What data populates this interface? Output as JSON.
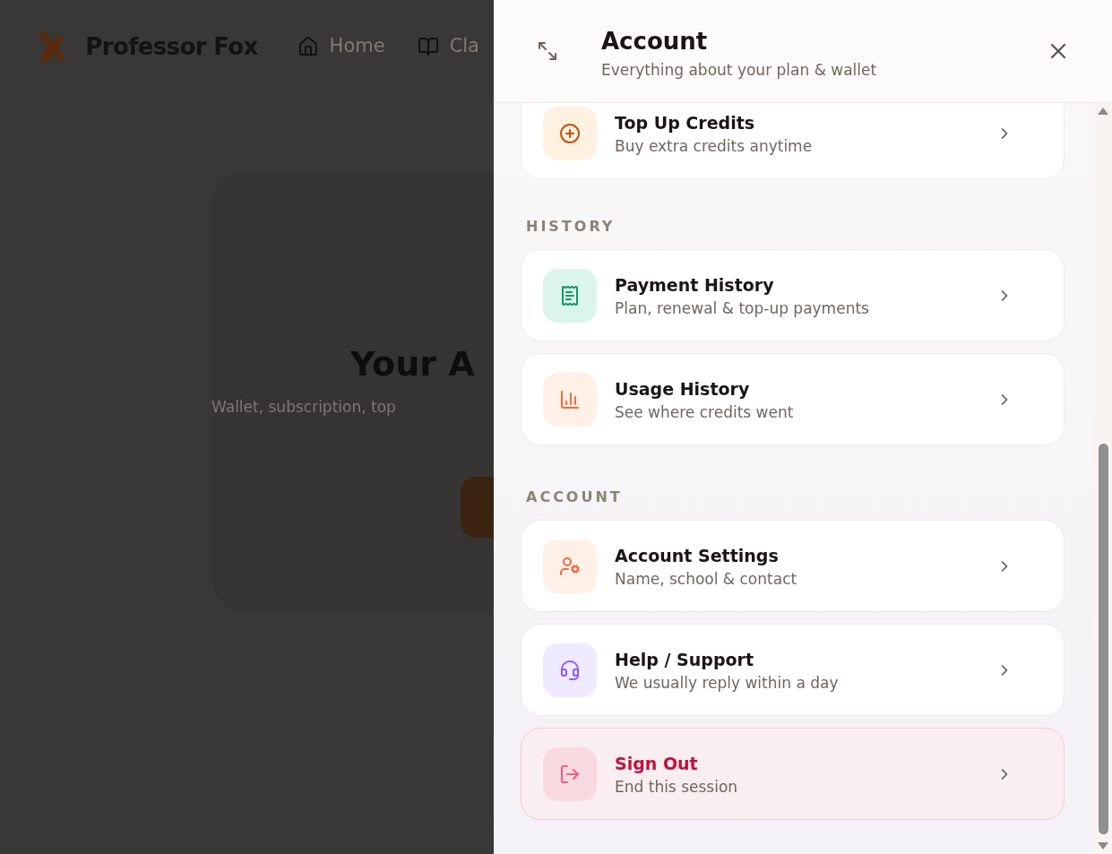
{
  "background": {
    "brand": "Professor Fox",
    "nav": [
      {
        "label": "Home",
        "kind": "home"
      },
      {
        "label": "Cla",
        "kind": "book"
      }
    ],
    "hero_title": "Your A",
    "hero_subtitle": "Wallet, subscription, top"
  },
  "drawer": {
    "title": "Account",
    "subtitle": "Everything about your plan & wallet",
    "sections": [
      {
        "items": [
          {
            "title": "Top Up Credits",
            "subtitle": "Buy extra credits anytime",
            "kind": "plus",
            "danger": false
          }
        ]
      },
      {
        "heading": "HISTORY",
        "items": [
          {
            "title": "Payment History",
            "subtitle": "Plan, renewal & top-up payments",
            "kind": "receipt",
            "danger": false
          },
          {
            "title": "Usage History",
            "subtitle": "See where credits went",
            "kind": "chart",
            "danger": false
          }
        ]
      },
      {
        "heading": "ACCOUNT",
        "items": [
          {
            "title": "Account Settings",
            "subtitle": "Name, school & contact",
            "kind": "user-gear",
            "danger": false
          },
          {
            "title": "Help / Support",
            "subtitle": "We usually reply within a day",
            "kind": "headset",
            "danger": false
          },
          {
            "title": "Sign Out",
            "subtitle": "End this session",
            "kind": "logout",
            "danger": true
          }
        ]
      }
    ]
  }
}
